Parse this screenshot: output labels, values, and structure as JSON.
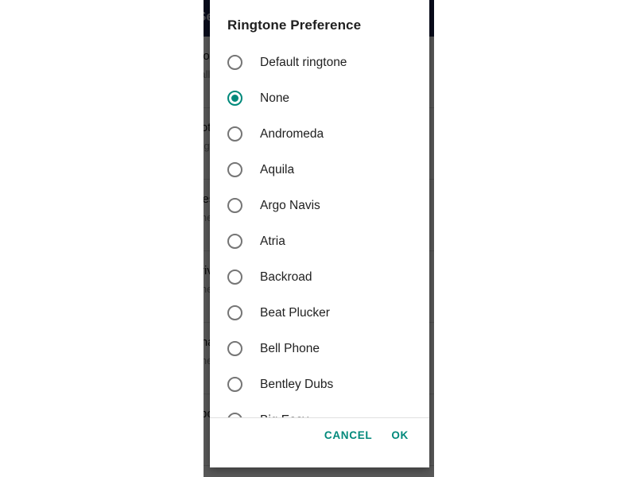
{
  "background": {
    "appbar": {
      "title": "Settings"
    },
    "list_rows": [
      {
        "title": "Block numbers",
        "subtitle": "Calls and messages"
      },
      {
        "title": "Notifications",
        "subtitle": "ringtone"
      },
      {
        "title": "Message settings",
        "subtitle": "tone"
      },
      {
        "title": "Privacy",
        "subtitle": "tone"
      },
      {
        "title": "Chat features",
        "subtitle": "tone"
      },
      {
        "title": "About",
        "subtitle": ""
      }
    ]
  },
  "dialog": {
    "title": "Ringtone Preference",
    "options": [
      {
        "label": "Default ringtone",
        "selected": false
      },
      {
        "label": "None",
        "selected": true
      },
      {
        "label": "Andromeda",
        "selected": false
      },
      {
        "label": "Aquila",
        "selected": false
      },
      {
        "label": "Argo Navis",
        "selected": false
      },
      {
        "label": "Atria",
        "selected": false
      },
      {
        "label": "Backroad",
        "selected": false
      },
      {
        "label": "Beat Plucker",
        "selected": false
      },
      {
        "label": "Bell Phone",
        "selected": false
      },
      {
        "label": "Bentley Dubs",
        "selected": false
      },
      {
        "label": "Big Easy",
        "selected": false
      }
    ],
    "actions": {
      "cancel_label": "CANCEL",
      "ok_label": "OK"
    }
  },
  "colors": {
    "accent": "#00897b",
    "appbar": "#1c2450",
    "scrim": "rgba(0,0,0,0.65)",
    "dialog_bg": "#ffffff",
    "text_primary": "#212121",
    "radio_unselected": "#757575"
  }
}
